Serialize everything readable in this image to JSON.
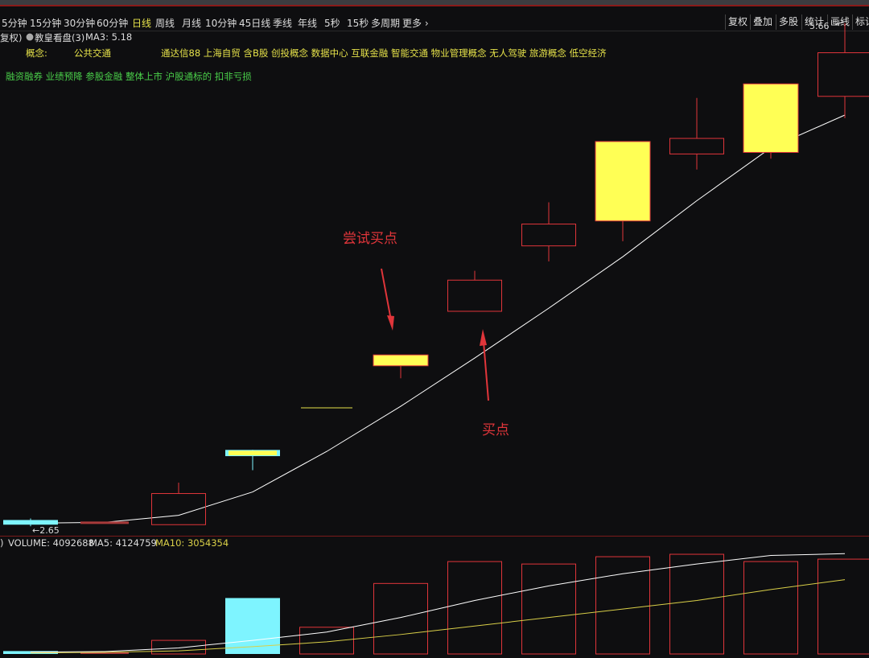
{
  "toolbar": {
    "timeframes": [
      "5分钟",
      "15分钟",
      "30分钟",
      "60分钟",
      "日线",
      "周线",
      "月线",
      "10分钟",
      "45日线",
      "季线",
      "年线",
      "5秒",
      "15秒",
      "多周期",
      "更多 ›"
    ],
    "active_timeframe": "日线",
    "right_buttons": [
      "复权",
      "叠加",
      "多股",
      "统计",
      "画线",
      "标记"
    ]
  },
  "info": {
    "adjust": "复权)",
    "indicator_name": "教皇看盘(3)",
    "ma_label": "MA3: 5.18",
    "concept_label": "概念:",
    "concept_main": "公共交通",
    "concepts": "通达信88  上海自贸  含B股  创投概念  数据中心  互联金融  智能交通  物业管理概念  无人驾驶  旅游概念  低空经济",
    "tags": "融资融券  业绩预降  参股金融  整体上市  沪股通标的  扣非亏损"
  },
  "volume_info": {
    "prefix": ")",
    "volume": "VOLUME: 4092688",
    "ma5": "MA5: 4124759",
    "ma10": "MA10: 3054354"
  },
  "colors": {
    "up": "#e0353a",
    "doji": "#e6e24a",
    "cyan": "#7ef4ff",
    "yellow_fill": "#ffff55",
    "ma": "#ffffff",
    "ma10": "#d9cf48",
    "annotation": "#e0353a"
  },
  "chart_data": {
    "type": "candlestick",
    "high_label": "5.66",
    "low_label": "2.65",
    "candles": [
      {
        "kind": "cyan",
        "open": 2.67,
        "close": 2.64,
        "high": 2.68,
        "low": 2.63
      },
      {
        "kind": "dash",
        "open": 2.655,
        "close": 2.655,
        "high": 2.66,
        "low": 2.65
      },
      {
        "kind": "up",
        "open": 2.64,
        "close": 2.84,
        "high": 2.91,
        "low": 2.64
      },
      {
        "kind": "cyan",
        "open": 3.12,
        "close": 3.08,
        "high": 3.12,
        "low": 2.99
      },
      {
        "kind": "line",
        "open": 3.39,
        "close": 3.39,
        "high": 3.39,
        "low": 3.39
      },
      {
        "kind": "yellow",
        "open": 3.73,
        "close": 3.66,
        "high": 3.73,
        "low": 3.58
      },
      {
        "kind": "up",
        "open": 4.01,
        "close": 4.21,
        "high": 4.27,
        "low": 4.01
      },
      {
        "kind": "up",
        "open": 4.43,
        "close": 4.57,
        "high": 4.71,
        "low": 4.33
      },
      {
        "kind": "yellow",
        "open": 5.1,
        "close": 4.59,
        "high": 5.1,
        "low": 4.46
      },
      {
        "kind": "up",
        "open": 5.02,
        "close": 5.12,
        "high": 5.38,
        "low": 4.92
      },
      {
        "kind": "yellow",
        "open": 5.47,
        "close": 5.03,
        "high": 5.47,
        "low": 4.99
      },
      {
        "kind": "up",
        "open": 5.39,
        "close": 5.67,
        "high": 5.86,
        "low": 5.25
      }
    ],
    "ma3": [
      2.65,
      2.655,
      2.7,
      2.85,
      3.11,
      3.4,
      3.71,
      4.03,
      4.36,
      4.72,
      5.06,
      5.27
    ],
    "volume": {
      "bars": [
        120000,
        80000,
        560000,
        2300000,
        1100000,
        2900000,
        3800000,
        3700000,
        4000000,
        4100000,
        3800000,
        3900000
      ],
      "bar_kinds": [
        "cyan",
        "dash",
        "up",
        "cyan",
        "up",
        "up",
        "up",
        "up",
        "up",
        "up",
        "up",
        "up"
      ],
      "ma5": [
        80000,
        100000,
        250000,
        560000,
        900000,
        1500000,
        2200000,
        2800000,
        3300000,
        3700000,
        4050000,
        4124759
      ],
      "ma10": [
        40000,
        70000,
        130000,
        300000,
        500000,
        800000,
        1150000,
        1500000,
        1850000,
        2200000,
        2650000,
        3054354
      ],
      "ylim": [
        0,
        4300000
      ]
    },
    "ylim": [
      2.6,
      5.74
    ],
    "annotations": [
      {
        "text": "尝试买点",
        "candle_index": 5
      },
      {
        "text": "买点",
        "candle_index": 6
      }
    ]
  }
}
